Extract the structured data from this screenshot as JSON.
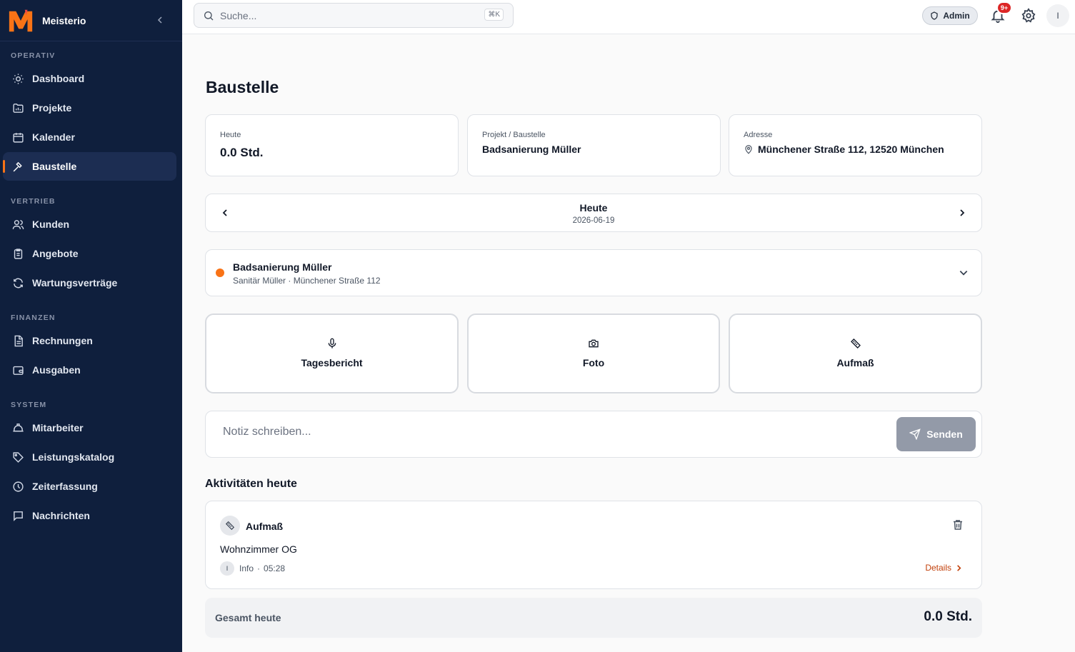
{
  "app": {
    "name": "Meisterio",
    "accent": "#f97316",
    "sidebar_bg": "#0f1f3d"
  },
  "sidebar": {
    "sections": [
      {
        "title": "OPERATIV",
        "items": [
          {
            "label": "Dashboard",
            "icon": "sun-icon",
            "active": false
          },
          {
            "label": "Projekte",
            "icon": "folder-chart-icon",
            "active": false
          },
          {
            "label": "Kalender",
            "icon": "calendar-icon",
            "active": false
          },
          {
            "label": "Baustelle",
            "icon": "hammer-icon",
            "active": true
          }
        ]
      },
      {
        "title": "VERTRIEB",
        "items": [
          {
            "label": "Kunden",
            "icon": "users-icon",
            "active": false
          },
          {
            "label": "Angebote",
            "icon": "clipboard-icon",
            "active": false
          },
          {
            "label": "Wartungsverträge",
            "icon": "refresh-icon",
            "active": false
          }
        ]
      },
      {
        "title": "FINANZEN",
        "items": [
          {
            "label": "Rechnungen",
            "icon": "file-text-icon",
            "active": false
          },
          {
            "label": "Ausgaben",
            "icon": "wallet-icon",
            "active": false
          }
        ]
      },
      {
        "title": "SYSTEM",
        "items": [
          {
            "label": "Mitarbeiter",
            "icon": "hard-hat-icon",
            "active": false
          },
          {
            "label": "Leistungskatalog",
            "icon": "tag-icon",
            "active": false
          },
          {
            "label": "Zeiterfassung",
            "icon": "clock-icon",
            "active": false
          },
          {
            "label": "Nachrichten",
            "icon": "message-icon",
            "active": false
          }
        ]
      }
    ]
  },
  "header": {
    "search_placeholder": "Suche...",
    "search_shortcut": "⌘K",
    "role_badge": "Admin",
    "notification_count": "9+",
    "avatar_initial": "I"
  },
  "page": {
    "title": "Baustelle",
    "stats": {
      "today_label": "Heute",
      "today_value": "0.0 Std.",
      "project_label": "Projekt / Baustelle",
      "project_value": "Badsanierung Müller",
      "address_label": "Adresse",
      "address_value": "Münchener Straße 112, 12520 München"
    },
    "date_nav": {
      "label": "Heute",
      "date": "2026-06-19"
    },
    "project_select": {
      "title": "Badsanierung Müller",
      "subtitle": "Sanitär Müller · Münchener Straße 112",
      "status_color": "#f97316"
    },
    "actions": [
      {
        "label": "Tagesbericht",
        "icon": "microphone-icon"
      },
      {
        "label": "Foto",
        "icon": "camera-icon"
      },
      {
        "label": "Aufmaß",
        "icon": "ruler-icon"
      }
    ],
    "note": {
      "placeholder": "Notiz schreiben...",
      "send_label": "Senden"
    },
    "activities_title": "Aktivitäten heute",
    "activity": {
      "type": "Aufmaß",
      "title": "Wohnzimmer OG",
      "author_initial": "I",
      "author": "Info",
      "separator": "·",
      "time": "05:28",
      "details_label": "Details"
    },
    "total": {
      "label": "Gesamt heute",
      "value": "0.0 Std."
    }
  }
}
